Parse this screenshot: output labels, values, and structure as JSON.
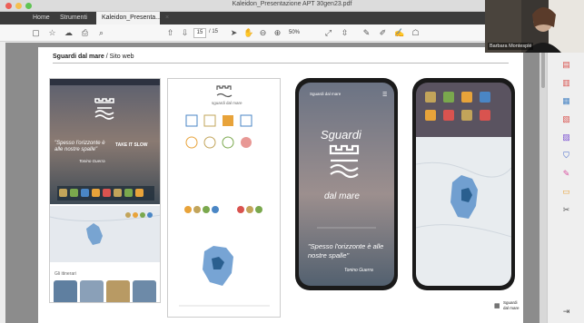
{
  "window": {
    "title": "Kaleidon_Presentazione APT 30gen23.pdf"
  },
  "tabs": [
    {
      "label": "Home"
    },
    {
      "label": "Strumenti"
    },
    {
      "label": "Kaleidon_Presenta...",
      "close": "×"
    }
  ],
  "toolbar": {
    "page_current": "15",
    "page_total": "/ 15",
    "zoom": "50%"
  },
  "document": {
    "breadcrumb_main": "Sguardi dal mare",
    "breadcrumb_sub": " / Sito web",
    "panel1": {
      "quote": "\"Spesso l'orizzonte è alle nostre spalle\"",
      "quote_author": "Tonino Guerra",
      "tagline": "TAKE IT SLOW",
      "section_label": "Gli itinerari"
    },
    "panel2": {
      "brand": "sguardi dal mare"
    },
    "phone1": {
      "menu_label": "Sguardi dal mare",
      "brand_line1": "Sguardi",
      "brand_line2": "dal mare",
      "quote": "\"Spesso l'orizzonte è alle nostre spalle\"",
      "author": "Tonino Guerra"
    },
    "footer_logo_line1": "Sguardi",
    "footer_logo_line2": "dal mare"
  },
  "webcam": {
    "name": "Barbara Montesplé"
  },
  "colors": {
    "teal": "#3d7f8f",
    "orange": "#e8a33a",
    "red": "#d9534f",
    "blue": "#4a86c5",
    "green": "#7aa84d"
  }
}
